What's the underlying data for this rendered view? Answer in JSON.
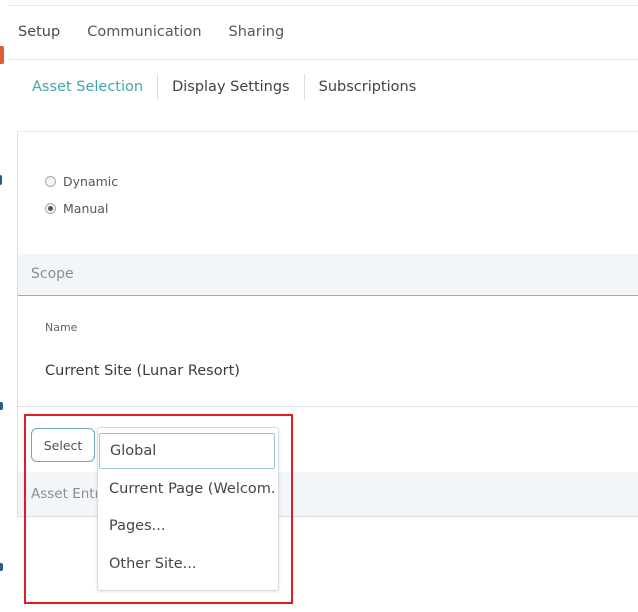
{
  "tabs": [
    "Setup",
    "Communication",
    "Sharing"
  ],
  "subtabs": [
    "Asset Selection",
    "Display Settings",
    "Subscriptions"
  ],
  "selection_mode": {
    "options": [
      "Dynamic",
      "Manual"
    ],
    "selected": "Manual"
  },
  "scope": {
    "header": "Scope",
    "name_label": "Name",
    "name_value": "Current Site (Lunar Resort)",
    "select_label": "Select"
  },
  "dropdown": {
    "items": [
      "Global",
      "Current Page (Welcom...",
      "Pages...",
      "Other Site..."
    ],
    "focused": "Global"
  },
  "asset_entries_header": "Asset Entr",
  "colors": {
    "accent": "#3fa6a7",
    "highlight": "#e01c22",
    "left_marks": [
      "#e05a3a",
      "#2b5b8c",
      "#2b5b8c",
      "#2b5b8c"
    ]
  }
}
